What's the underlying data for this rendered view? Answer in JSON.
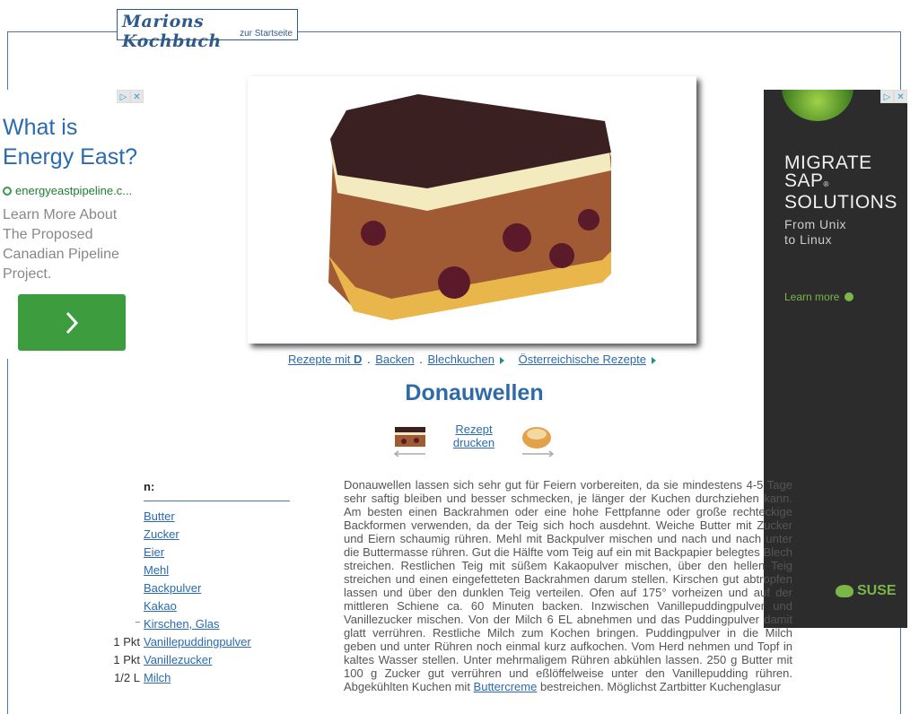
{
  "header": {
    "logo_title": "Marions Kochbuch",
    "logo_subtitle": "zur Startseite"
  },
  "ad_left": {
    "headline": "What is Energy East?",
    "url": "energyeastpipeline.c...",
    "description": "Learn More About The Proposed Canadian Pipeline Project.",
    "button_icon": "chevron-right-icon",
    "adchoices_icon": "▷",
    "close_icon": "✕"
  },
  "ad_right": {
    "line1": "MIGRATE",
    "line2": "SAP",
    "reg": "®",
    "line3": "SOLUTIONS",
    "sub1": "From Unix",
    "sub2": "to Linux",
    "learn_more": "Learn more",
    "brand": "SUSE",
    "adchoices_icon": "▷",
    "close_icon": "✕"
  },
  "breadcrumbs": [
    {
      "prefix": "Rezepte mit ",
      "bold": "D"
    },
    "Backen",
    "Blechkuchen",
    "Österreichische Rezepte"
  ],
  "title": "Donauwellen",
  "nav": {
    "print_line1": "Rezept",
    "print_line2": "drucken"
  },
  "ingredients": {
    "heading_visible": "n:",
    "items": [
      {
        "qty": "",
        "name": "Butter"
      },
      {
        "qty": "",
        "name": "Zucker"
      },
      {
        "qty": "",
        "name": "Eier"
      },
      {
        "qty": "",
        "name": "Mehl"
      },
      {
        "qty": "",
        "name": "Backpulver"
      },
      {
        "qty": "",
        "name": "Kakao"
      },
      {
        "qty": "–",
        "name": "Kirschen, Glas"
      },
      {
        "qty": "1 Pkt",
        "name": "Vanillepuddingpulver"
      },
      {
        "qty": "1 Pkt",
        "name": "Vanillezucker"
      },
      {
        "qty": "1/2 L",
        "name": "Milch"
      }
    ]
  },
  "description": {
    "before_link": "Donauwellen lassen sich sehr gut für Feiern vorbereiten, da sie mindestens 4-5 Tage sehr saftig bleiben und besser schmecken, je länger der Kuchen durchziehen kann. Am besten einen Backrahmen oder eine hohe Fettpfanne oder große rechteckige Backformen verwenden, da der Teig sich hoch ausdehnt. Weiche Butter mit Zucker und Eiern schaumig rühren. Mehl mit Backpulver mischen und nach und nach unter die Buttermasse rühren. Gut die Hälfte vom Teig auf ein mit Backpapier belegtes Blech streichen. Restlichen Teig mit süßem Kakaopulver mischen, über den hellen Teig streichen und einen eingefetteten Backrahmen darum stellen. Kirschen gut abtropfen lassen und über den dunklen Teig verteilen. Ofen auf 175° vorheizen und auf der mittleren Schiene ca. 60 Minuten backen. Inzwischen Vanillepuddingpulver und Vanillezucker mischen. Von der Milch 6 EL abnehmen und das Puddingpulver damit glatt verrühren. Restliche Milch zum Kochen bringen. Puddingpulver in die Milch geben und unter Rühren noch einmal kurz aufkochen. Vom Herd nehmen und Topf in kaltes Wasser stellen. Unter mehrmaligem Rühren abkühlen lassen. 250 g Butter mit 100 g Zucker gut verrühren und eßlöffelweise unter den Vanillepudding rühren. Abgekühlten Kuchen mit ",
    "link": "Buttercreme",
    "after_link": " bestreichen. Möglichst Zartbitter Kuchenglasur"
  }
}
